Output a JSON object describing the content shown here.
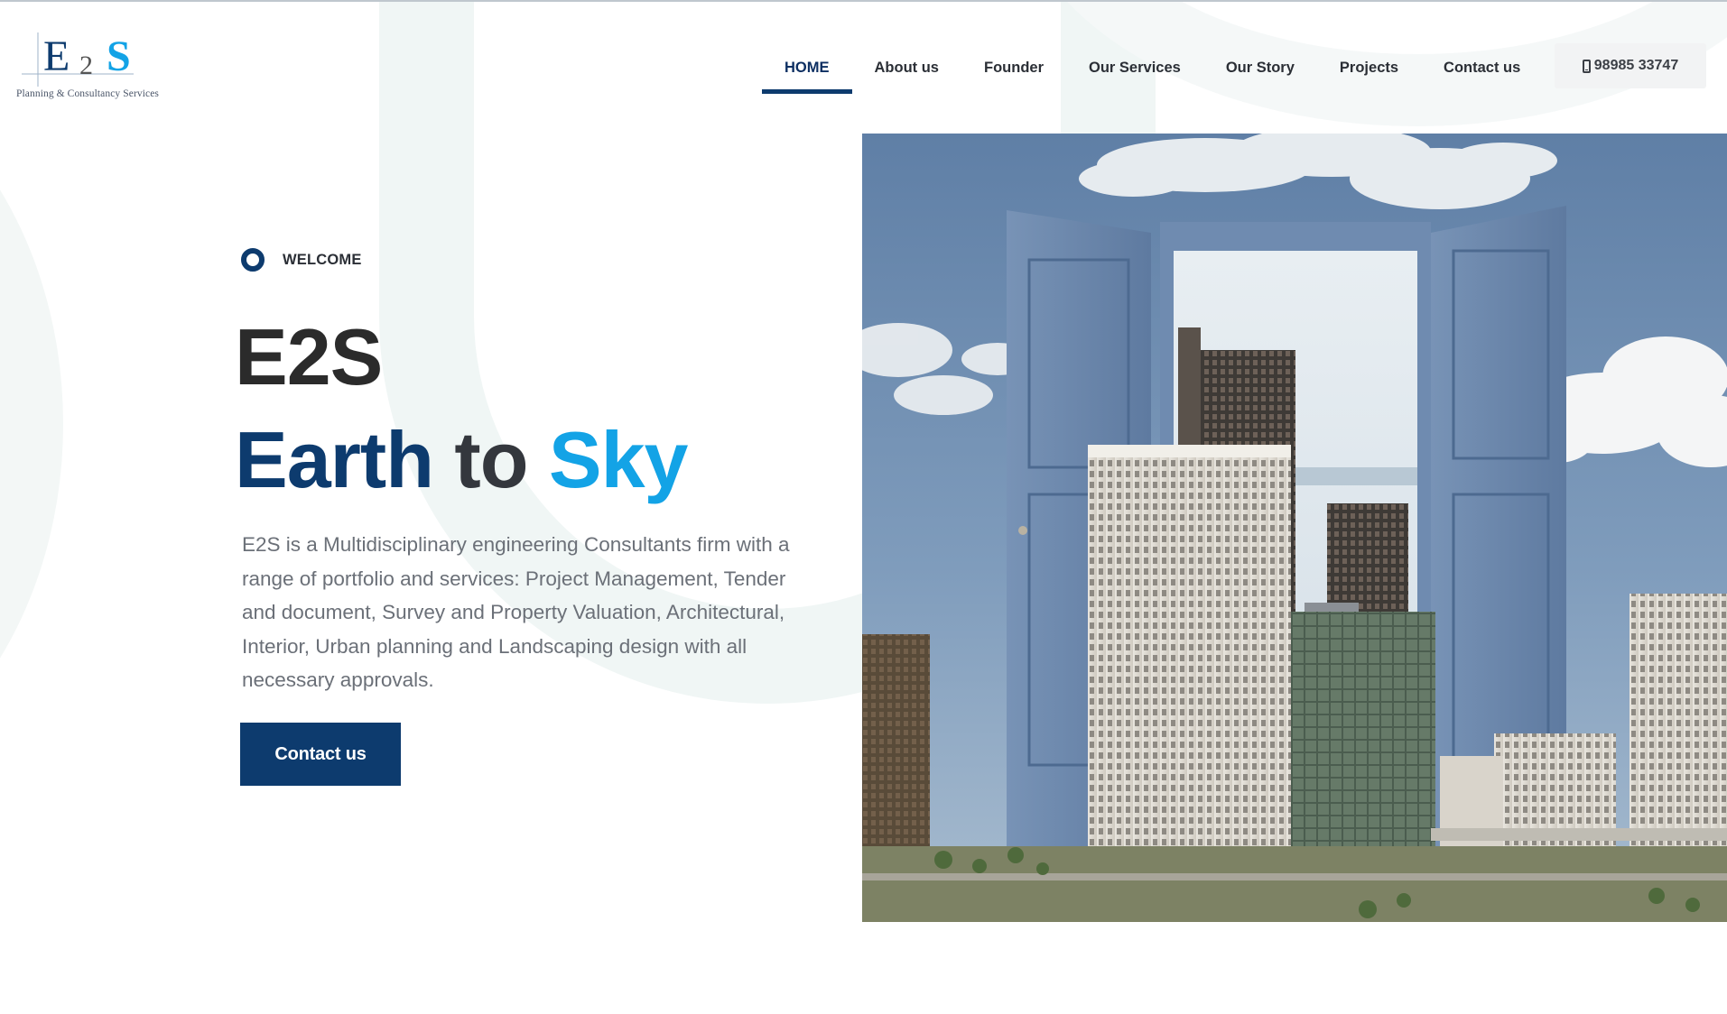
{
  "brand": {
    "logo_text": "E2S",
    "tagline": "Planning & Consultancy Services"
  },
  "nav": {
    "items": [
      {
        "label": "HOME",
        "active": true
      },
      {
        "label": "About us"
      },
      {
        "label": "Founder"
      },
      {
        "label": "Our Services"
      },
      {
        "label": "Our Story"
      },
      {
        "label": "Projects"
      },
      {
        "label": "Contact us"
      }
    ],
    "phone": "98985 33747"
  },
  "hero": {
    "eyebrow": "WELCOME",
    "title": "E2S",
    "subtitle_part1": "Earth",
    "subtitle_part2": "to",
    "subtitle_part3": "Sky",
    "description": "E2S is a Multidisciplinary engineering Consultants firm with a range of portfolio and services: Project Management, Tender and document, Survey and Property Valuation, Architectural, Interior, Urban planning and Landscaping design with all necessary approvals.",
    "cta_label": "Contact us"
  },
  "colors": {
    "primary": "#0d3b6e",
    "accent": "#13a3e6",
    "text_dark": "#2b2b2b",
    "text_muted": "#6b7078"
  },
  "icons": {
    "phone": "mobile-phone-icon",
    "welcome": "ring-icon"
  }
}
